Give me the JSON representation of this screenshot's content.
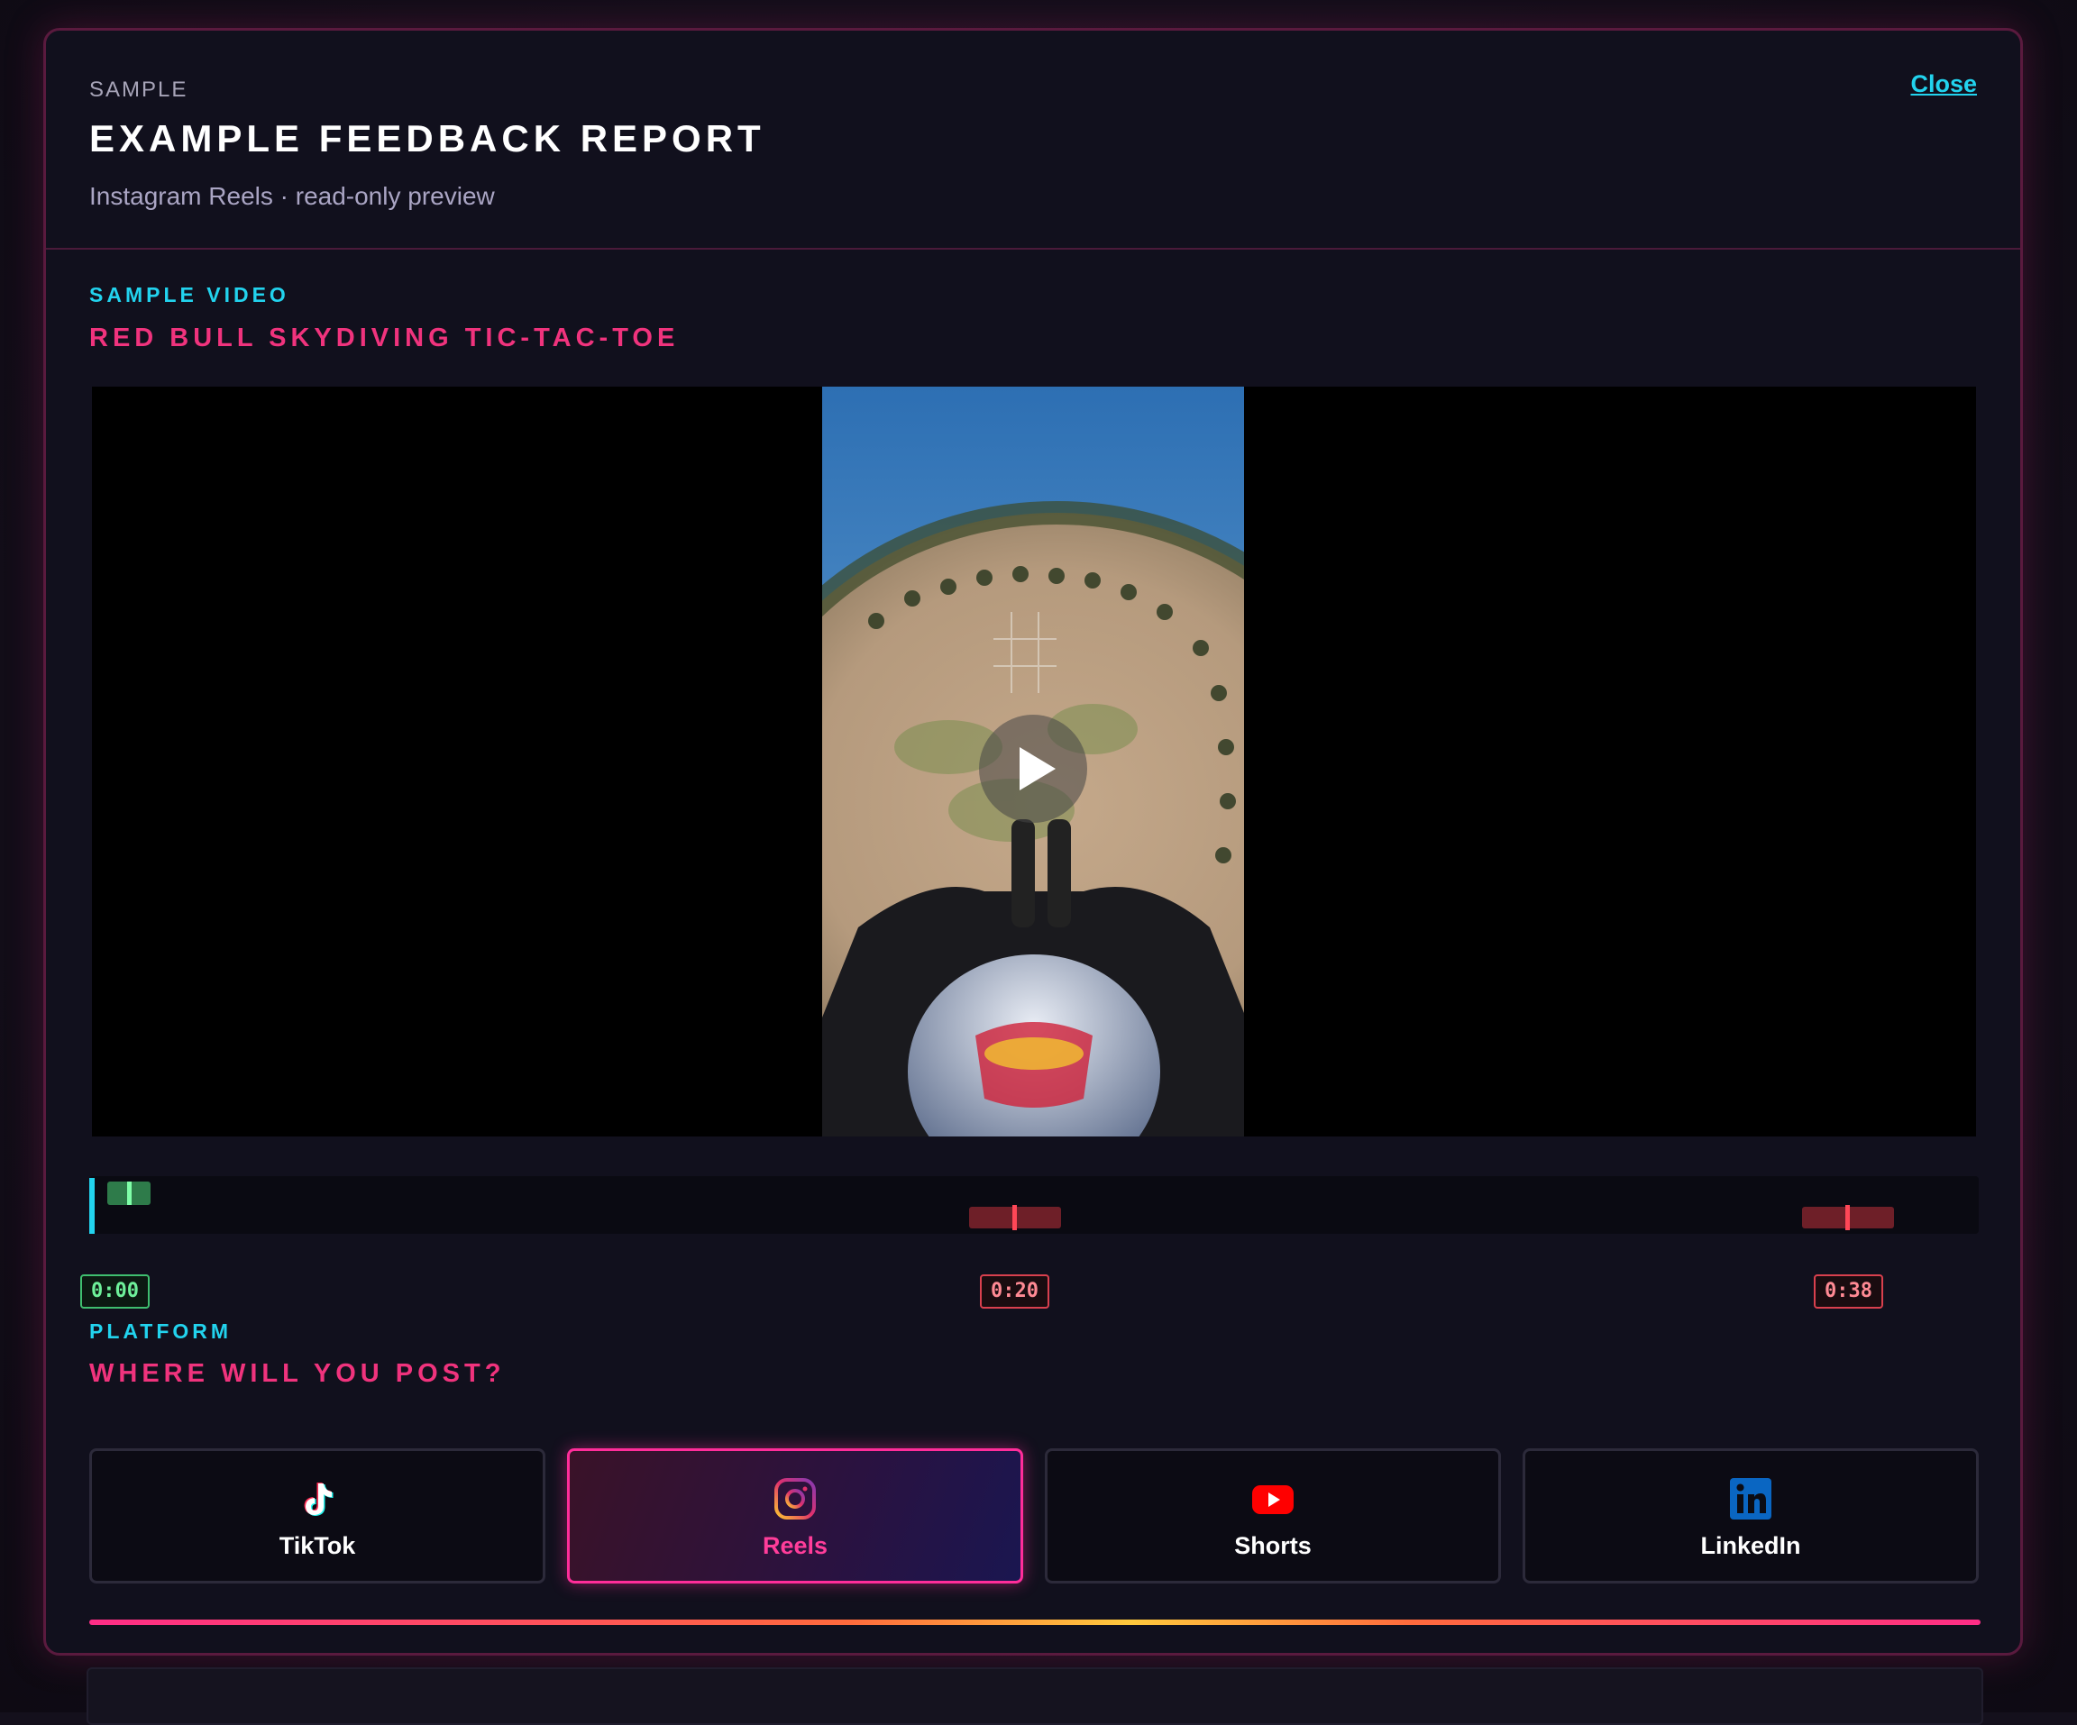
{
  "header": {
    "eyebrow": "SAMPLE",
    "title": "EXAMPLE FEEDBACK REPORT",
    "subtitle": "Instagram Reels · read-only preview",
    "close_label": "Close"
  },
  "video_section": {
    "eyebrow": "SAMPLE VIDEO",
    "title": "RED BULL SKYDIVING TIC-TAC-TOE",
    "play_icon": "play-icon"
  },
  "timeline": {
    "markers": [
      {
        "time": "0:00",
        "kind": "green"
      },
      {
        "time": "0:20",
        "kind": "red"
      },
      {
        "time": "0:38",
        "kind": "red"
      }
    ],
    "colors": {
      "playhead": "#22d3ee",
      "good": "#3fbf6f",
      "issue": "#d9404e"
    }
  },
  "platform_section": {
    "eyebrow": "PLATFORM",
    "title": "WHERE WILL YOU POST?",
    "options": [
      {
        "label": "TikTok",
        "icon": "tiktok-icon",
        "selected": false
      },
      {
        "label": "Reels",
        "icon": "instagram-icon",
        "selected": true
      },
      {
        "label": "Shorts",
        "icon": "youtube-icon",
        "selected": false
      },
      {
        "label": "LinkedIn",
        "icon": "linkedin-icon",
        "selected": false
      }
    ]
  },
  "colors": {
    "accent_cyan": "#22d3ee",
    "accent_pink": "#f0337d",
    "modal_border": "#5a1a3e",
    "background": "#11101d"
  }
}
